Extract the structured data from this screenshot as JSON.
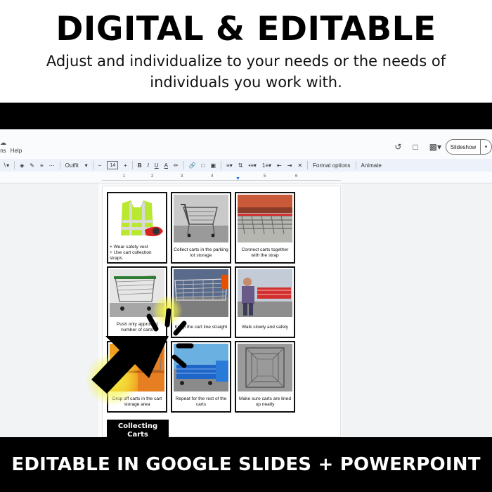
{
  "header": {
    "title": "DIGITAL & EDITABLE",
    "subtitle_line1": "Adjust and individualize to your needs or the needs of",
    "subtitle_line2": "individuals you work with."
  },
  "footer": {
    "banner": "EDITABLE IN GOOGLE SLIDES + POWERPOINT"
  },
  "app": {
    "menu": [
      "ions",
      "Help"
    ],
    "slideshow_label": "Slideshow",
    "toolbar": {
      "font": "Outfit",
      "font_size": "14",
      "bold": "B",
      "italic": "I",
      "underline": "U",
      "text_color": "A",
      "format_options": "Format options",
      "animate": "Animate"
    },
    "ruler": [
      "1",
      "2",
      "3",
      "4",
      "5",
      "6"
    ]
  },
  "slide": {
    "cards": [
      {
        "caption": "+ Wear safety vest\n+ Use cart collection straps",
        "image": "safety-vest-photo"
      },
      {
        "caption": "Collect carts in the parking lot storage",
        "image": "shopping-cart-photo"
      },
      {
        "caption": "Connect carts together with the strap",
        "image": "connected-carts-photo"
      },
      {
        "caption": "Push only approved number of carts",
        "image": "pushing-carts-photo"
      },
      {
        "caption": "Keep the cart line straight",
        "image": "cart-line-photo"
      },
      {
        "caption": "Walk slowly and safely",
        "image": "walking-carts-photo"
      },
      {
        "caption": "Drop off carts in the cart storage area",
        "image": "storage-area-photo"
      },
      {
        "caption": "Repeat for the rest of the carts",
        "image": "blue-carts-photo"
      },
      {
        "caption": "Make sure carts are lined up neatly",
        "image": "lined-carts-photo"
      }
    ],
    "title_card": "Collecting Carts"
  },
  "colors": {
    "accent_blue": "#1a73e8",
    "highlight_yellow": "#f5f542",
    "toolbar_bg": "#edf2fa"
  }
}
